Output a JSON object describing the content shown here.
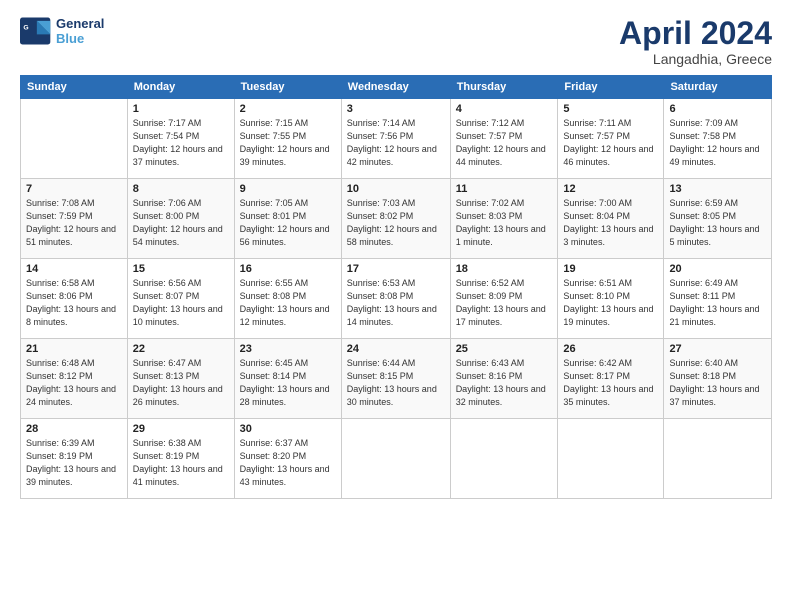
{
  "logo": {
    "line1": "General",
    "line2": "Blue"
  },
  "title": "April 2024",
  "subtitle": "Langadhia, Greece",
  "weekdays": [
    "Sunday",
    "Monday",
    "Tuesday",
    "Wednesday",
    "Thursday",
    "Friday",
    "Saturday"
  ],
  "weeks": [
    [
      {
        "day": "",
        "sunrise": "",
        "sunset": "",
        "daylight": ""
      },
      {
        "day": "1",
        "sunrise": "Sunrise: 7:17 AM",
        "sunset": "Sunset: 7:54 PM",
        "daylight": "Daylight: 12 hours and 37 minutes."
      },
      {
        "day": "2",
        "sunrise": "Sunrise: 7:15 AM",
        "sunset": "Sunset: 7:55 PM",
        "daylight": "Daylight: 12 hours and 39 minutes."
      },
      {
        "day": "3",
        "sunrise": "Sunrise: 7:14 AM",
        "sunset": "Sunset: 7:56 PM",
        "daylight": "Daylight: 12 hours and 42 minutes."
      },
      {
        "day": "4",
        "sunrise": "Sunrise: 7:12 AM",
        "sunset": "Sunset: 7:57 PM",
        "daylight": "Daylight: 12 hours and 44 minutes."
      },
      {
        "day": "5",
        "sunrise": "Sunrise: 7:11 AM",
        "sunset": "Sunset: 7:57 PM",
        "daylight": "Daylight: 12 hours and 46 minutes."
      },
      {
        "day": "6",
        "sunrise": "Sunrise: 7:09 AM",
        "sunset": "Sunset: 7:58 PM",
        "daylight": "Daylight: 12 hours and 49 minutes."
      }
    ],
    [
      {
        "day": "7",
        "sunrise": "Sunrise: 7:08 AM",
        "sunset": "Sunset: 7:59 PM",
        "daylight": "Daylight: 12 hours and 51 minutes."
      },
      {
        "day": "8",
        "sunrise": "Sunrise: 7:06 AM",
        "sunset": "Sunset: 8:00 PM",
        "daylight": "Daylight: 12 hours and 54 minutes."
      },
      {
        "day": "9",
        "sunrise": "Sunrise: 7:05 AM",
        "sunset": "Sunset: 8:01 PM",
        "daylight": "Daylight: 12 hours and 56 minutes."
      },
      {
        "day": "10",
        "sunrise": "Sunrise: 7:03 AM",
        "sunset": "Sunset: 8:02 PM",
        "daylight": "Daylight: 12 hours and 58 minutes."
      },
      {
        "day": "11",
        "sunrise": "Sunrise: 7:02 AM",
        "sunset": "Sunset: 8:03 PM",
        "daylight": "Daylight: 13 hours and 1 minute."
      },
      {
        "day": "12",
        "sunrise": "Sunrise: 7:00 AM",
        "sunset": "Sunset: 8:04 PM",
        "daylight": "Daylight: 13 hours and 3 minutes."
      },
      {
        "day": "13",
        "sunrise": "Sunrise: 6:59 AM",
        "sunset": "Sunset: 8:05 PM",
        "daylight": "Daylight: 13 hours and 5 minutes."
      }
    ],
    [
      {
        "day": "14",
        "sunrise": "Sunrise: 6:58 AM",
        "sunset": "Sunset: 8:06 PM",
        "daylight": "Daylight: 13 hours and 8 minutes."
      },
      {
        "day": "15",
        "sunrise": "Sunrise: 6:56 AM",
        "sunset": "Sunset: 8:07 PM",
        "daylight": "Daylight: 13 hours and 10 minutes."
      },
      {
        "day": "16",
        "sunrise": "Sunrise: 6:55 AM",
        "sunset": "Sunset: 8:08 PM",
        "daylight": "Daylight: 13 hours and 12 minutes."
      },
      {
        "day": "17",
        "sunrise": "Sunrise: 6:53 AM",
        "sunset": "Sunset: 8:08 PM",
        "daylight": "Daylight: 13 hours and 14 minutes."
      },
      {
        "day": "18",
        "sunrise": "Sunrise: 6:52 AM",
        "sunset": "Sunset: 8:09 PM",
        "daylight": "Daylight: 13 hours and 17 minutes."
      },
      {
        "day": "19",
        "sunrise": "Sunrise: 6:51 AM",
        "sunset": "Sunset: 8:10 PM",
        "daylight": "Daylight: 13 hours and 19 minutes."
      },
      {
        "day": "20",
        "sunrise": "Sunrise: 6:49 AM",
        "sunset": "Sunset: 8:11 PM",
        "daylight": "Daylight: 13 hours and 21 minutes."
      }
    ],
    [
      {
        "day": "21",
        "sunrise": "Sunrise: 6:48 AM",
        "sunset": "Sunset: 8:12 PM",
        "daylight": "Daylight: 13 hours and 24 minutes."
      },
      {
        "day": "22",
        "sunrise": "Sunrise: 6:47 AM",
        "sunset": "Sunset: 8:13 PM",
        "daylight": "Daylight: 13 hours and 26 minutes."
      },
      {
        "day": "23",
        "sunrise": "Sunrise: 6:45 AM",
        "sunset": "Sunset: 8:14 PM",
        "daylight": "Daylight: 13 hours and 28 minutes."
      },
      {
        "day": "24",
        "sunrise": "Sunrise: 6:44 AM",
        "sunset": "Sunset: 8:15 PM",
        "daylight": "Daylight: 13 hours and 30 minutes."
      },
      {
        "day": "25",
        "sunrise": "Sunrise: 6:43 AM",
        "sunset": "Sunset: 8:16 PM",
        "daylight": "Daylight: 13 hours and 32 minutes."
      },
      {
        "day": "26",
        "sunrise": "Sunrise: 6:42 AM",
        "sunset": "Sunset: 8:17 PM",
        "daylight": "Daylight: 13 hours and 35 minutes."
      },
      {
        "day": "27",
        "sunrise": "Sunrise: 6:40 AM",
        "sunset": "Sunset: 8:18 PM",
        "daylight": "Daylight: 13 hours and 37 minutes."
      }
    ],
    [
      {
        "day": "28",
        "sunrise": "Sunrise: 6:39 AM",
        "sunset": "Sunset: 8:19 PM",
        "daylight": "Daylight: 13 hours and 39 minutes."
      },
      {
        "day": "29",
        "sunrise": "Sunrise: 6:38 AM",
        "sunset": "Sunset: 8:19 PM",
        "daylight": "Daylight: 13 hours and 41 minutes."
      },
      {
        "day": "30",
        "sunrise": "Sunrise: 6:37 AM",
        "sunset": "Sunset: 8:20 PM",
        "daylight": "Daylight: 13 hours and 43 minutes."
      },
      {
        "day": "",
        "sunrise": "",
        "sunset": "",
        "daylight": ""
      },
      {
        "day": "",
        "sunrise": "",
        "sunset": "",
        "daylight": ""
      },
      {
        "day": "",
        "sunrise": "",
        "sunset": "",
        "daylight": ""
      },
      {
        "day": "",
        "sunrise": "",
        "sunset": "",
        "daylight": ""
      }
    ]
  ]
}
